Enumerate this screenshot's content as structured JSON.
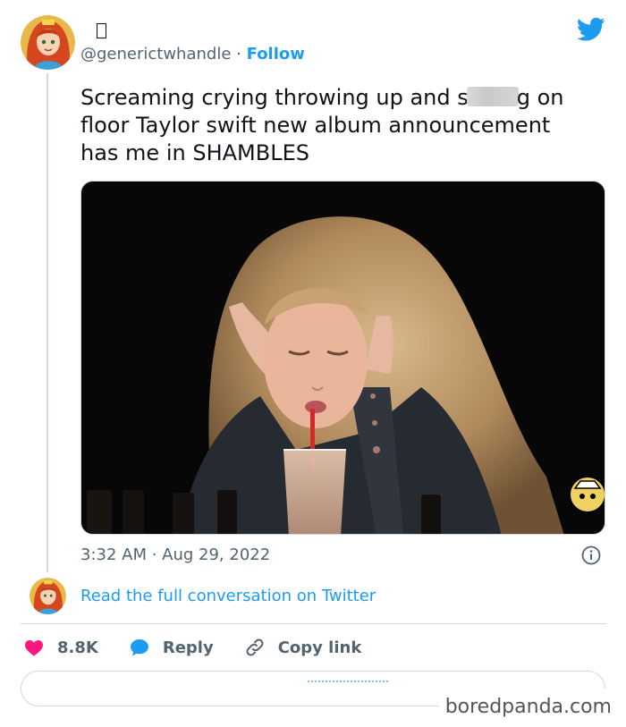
{
  "tweet": {
    "display_name_glyph": "missing-glyph",
    "handle": "@generictwhandle",
    "separator": "·",
    "follow_label": "Follow",
    "text": {
      "line1_before": "Screaming crying throwing up and s",
      "line1_after": "g on",
      "line2": "floor Taylor swift new album announcement",
      "line3": "has me in SHAMBLES"
    },
    "timestamp": "3:32 AM · Aug 29, 2022",
    "read_full_conversation": "Read the full conversation on Twitter"
  },
  "actions": {
    "like_count": "8.8K",
    "reply_label": "Reply",
    "copy_link_label": "Copy link"
  },
  "watermark": "boredpanda.com",
  "icons": {
    "brand": "twitter-bird-icon",
    "info": "info-icon",
    "like": "heart-icon",
    "reply": "speech-bubble-icon",
    "copy": "link-icon"
  },
  "colors": {
    "accent": "#1d9bf0",
    "like": "#f91880",
    "text": "#0f1419",
    "secondary": "#536471",
    "border": "#cfd9de"
  }
}
